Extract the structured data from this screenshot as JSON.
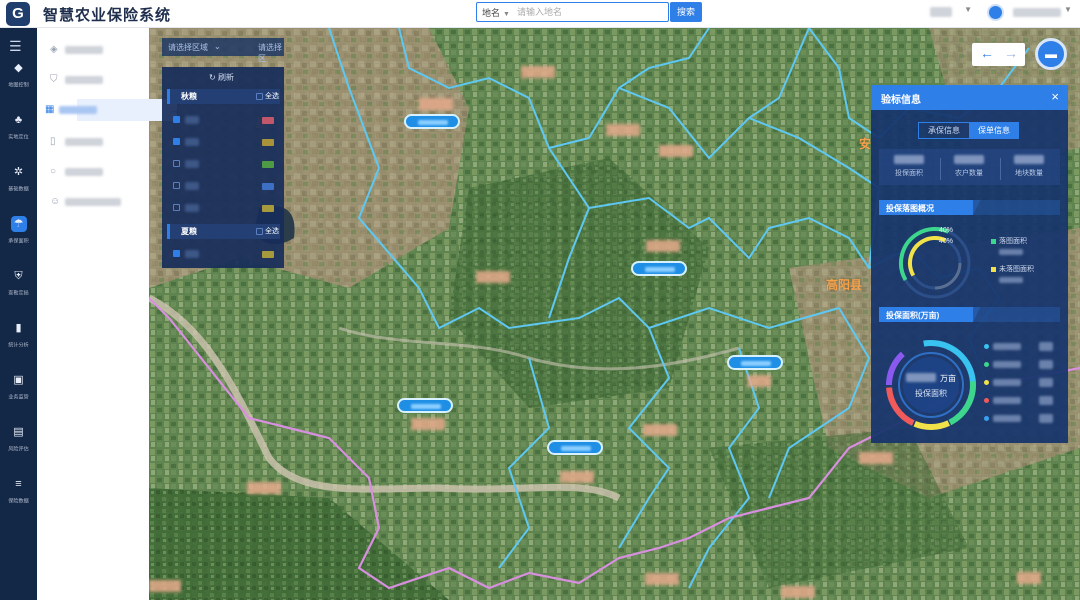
{
  "app": {
    "title": "智慧农业保险系统",
    "logo_text": "G"
  },
  "search": {
    "type_label": "地名",
    "placeholder": "请输入地名",
    "button_label": "搜索"
  },
  "sidebar": {
    "items": [
      {
        "label": "地图控制",
        "icon": "cube-icon",
        "glyph": "◆"
      },
      {
        "label": "实地定位",
        "icon": "location-people-icon",
        "glyph": "♣"
      },
      {
        "label": "基础数据",
        "icon": "network-icon",
        "glyph": "✲"
      },
      {
        "label": "承保面积",
        "icon": "umbrella-icon",
        "glyph": "☂",
        "active": true
      },
      {
        "label": "查勘定损",
        "icon": "shield-icon",
        "glyph": "⛨"
      },
      {
        "label": "统计分析",
        "icon": "bar-chart-icon",
        "glyph": "▮"
      },
      {
        "label": "业务监管",
        "icon": "monitor-chart-icon",
        "glyph": "▣"
      },
      {
        "label": "风险评估",
        "icon": "document-icon",
        "glyph": "▤"
      },
      {
        "label": "保险数据",
        "icon": "database-icon",
        "glyph": "≡"
      }
    ]
  },
  "map": {
    "region_select_placeholder": "请选择区域",
    "second_select_placeholder": "请选择区",
    "county_names": [
      "县",
      "高阳县",
      "安"
    ],
    "boundary_colors": {
      "county": "#5ec8f2",
      "province": "#d88fe0"
    }
  },
  "layer_panel": {
    "refresh_label": "刷新",
    "groups": [
      {
        "title": "秋粮",
        "select_all": "全选",
        "select_all_checked": false,
        "rows": [
          {
            "checked": true,
            "color": "#c2566a"
          },
          {
            "checked": true,
            "color": "#a8933a"
          },
          {
            "checked": false,
            "color": "#4f9a45"
          },
          {
            "checked": false,
            "color": "#3d6fc5"
          },
          {
            "checked": false,
            "color": "#a69a3c"
          }
        ]
      },
      {
        "title": "夏粮",
        "select_all": "全选",
        "select_all_checked": false,
        "rows": [
          {
            "checked": true,
            "color": "#a69a3c"
          }
        ]
      }
    ]
  },
  "info_panel": {
    "title": "验标信息",
    "close_glyph": "×",
    "tabs": [
      {
        "label": "承保信息",
        "active": false
      },
      {
        "label": "保单信息",
        "active": true
      }
    ],
    "stats": [
      {
        "label": "投保面积"
      },
      {
        "label": "农户数量"
      },
      {
        "label": "地块数量"
      }
    ],
    "section1": {
      "title": "投保落图概况",
      "percent_a": "40%",
      "percent_b": "40%",
      "legend": [
        {
          "label": "落图面积",
          "color": "#3dd68c"
        },
        {
          "label": "未落图面积",
          "color": "#f2e24a"
        }
      ]
    },
    "section2": {
      "title": "投保面积(万亩)",
      "center_unit": "万亩",
      "center_label": "投保面积",
      "legend_colors": [
        "#39c3f0",
        "#3dd68c",
        "#f2e24a",
        "#f05a5a",
        "#39a0f0"
      ]
    }
  },
  "colors": {
    "accent": "#2f7fe8",
    "sidebar_bg": "#132746",
    "panel_bg": "#16346c"
  }
}
